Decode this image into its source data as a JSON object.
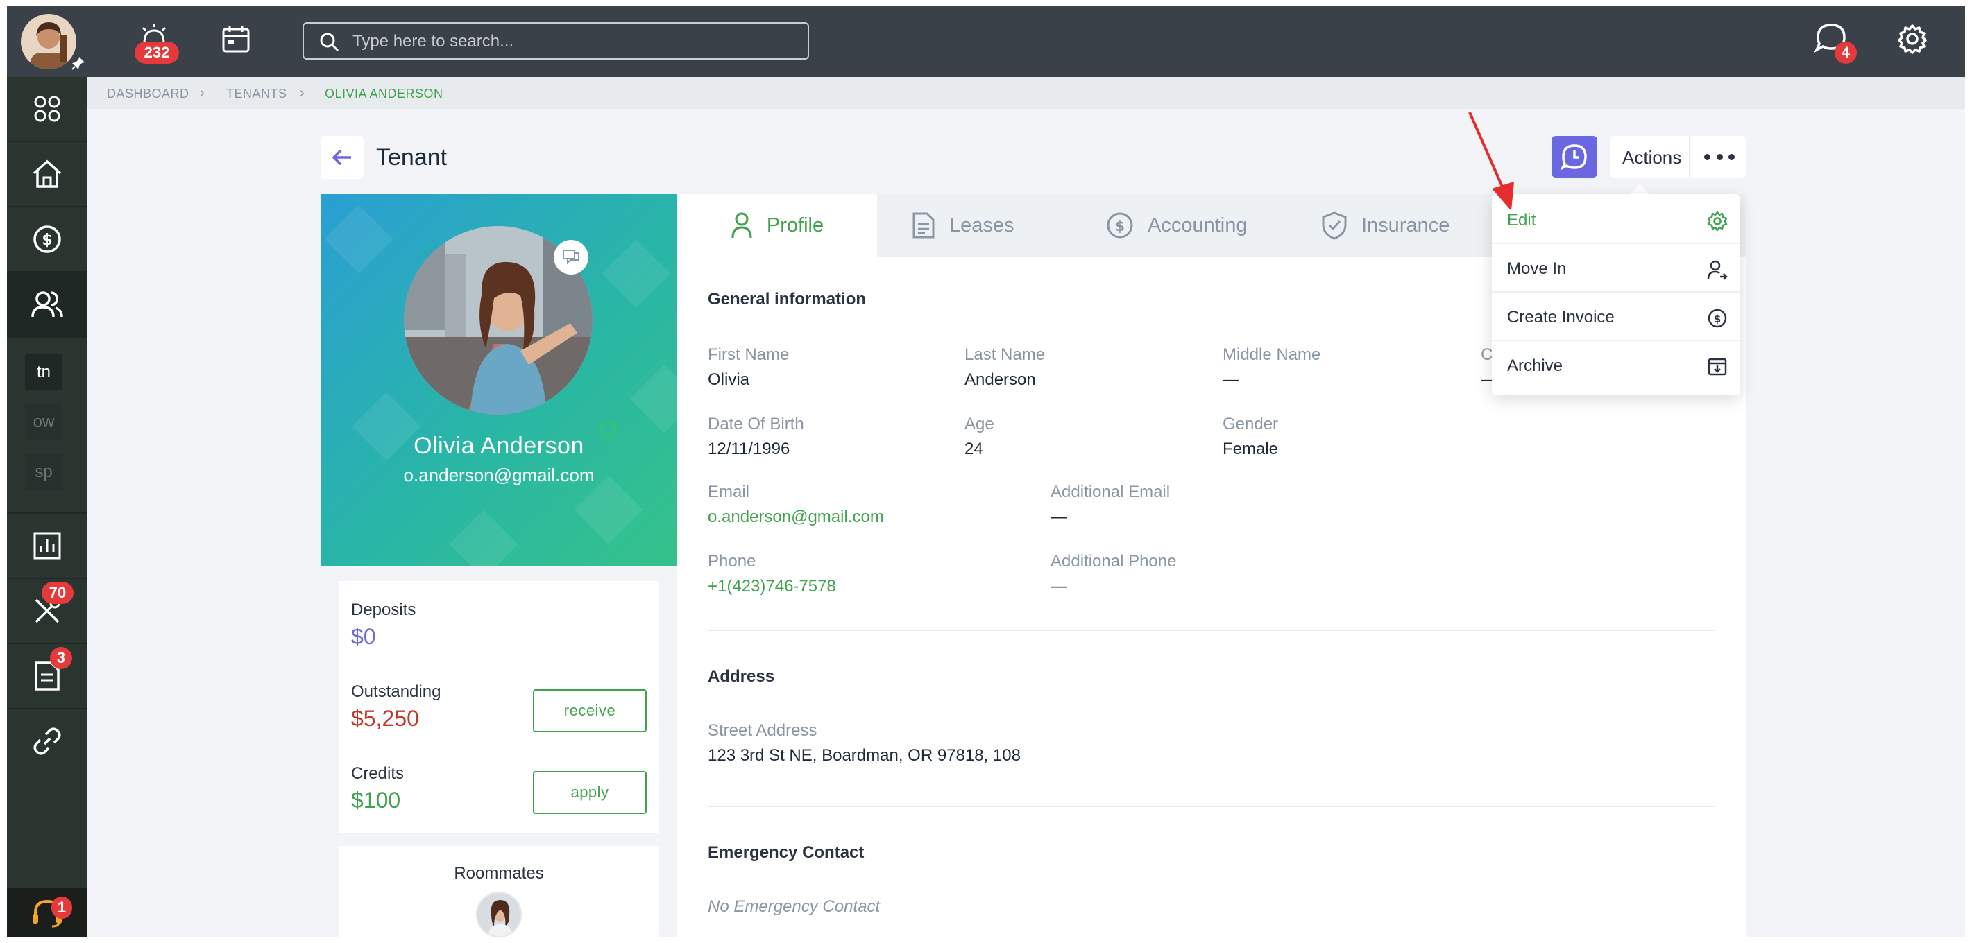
{
  "topbar": {
    "alerts_count": "232",
    "search_placeholder": "Type here to search...",
    "messages_count": "4"
  },
  "sidebar": {
    "items": [
      {
        "name": "apps"
      },
      {
        "name": "home"
      },
      {
        "name": "accounting"
      },
      {
        "name": "people"
      }
    ],
    "accounts": [
      "tn",
      "ow",
      "sp"
    ],
    "maintenance_badge": "70",
    "documents_badge": "3",
    "support_badge": "1"
  },
  "breadcrumb": [
    "DASHBOARD",
    "TENANTS",
    "OLIVIA ANDERSON"
  ],
  "page": {
    "title": "Tenant",
    "actions_label": "Actions"
  },
  "profile": {
    "name": "Olivia Anderson",
    "email": "o.anderson@gmail.com"
  },
  "finance": {
    "deposits_label": "Deposits",
    "deposits_value": "$0",
    "outstanding_label": "Outstanding",
    "outstanding_value": "$5,250",
    "receive_label": "receive",
    "credits_label": "Credits",
    "credits_value": "$100",
    "apply_label": "apply"
  },
  "roommates": {
    "title": "Roommates"
  },
  "tabs": [
    "Profile",
    "Leases",
    "Accounting",
    "Insurance"
  ],
  "general": {
    "title": "General information",
    "first_name_label": "First Name",
    "first_name": "Olivia",
    "last_name_label": "Last Name",
    "last_name": "Anderson",
    "middle_name_label": "Middle Name",
    "middle_name": "—",
    "hidden_label": "C",
    "hidden_value": "—",
    "dob_label": "Date Of Birth",
    "dob": "12/11/1996",
    "age_label": "Age",
    "age": "24",
    "gender_label": "Gender",
    "gender": "Female",
    "email_label": "Email",
    "email": "o.anderson@gmail.com",
    "add_email_label": "Additional Email",
    "add_email": "—",
    "phone_label": "Phone",
    "phone": "+1(423)746-7578",
    "add_phone_label": "Additional Phone",
    "add_phone": "—"
  },
  "address": {
    "title": "Address",
    "street_label": "Street Address",
    "street": "123 3rd St NE, Boardman, OR 97818, 108"
  },
  "emergency": {
    "title": "Emergency Contact",
    "empty": "No Emergency Contact"
  },
  "dropdown": {
    "items": [
      "Edit",
      "Move In",
      "Create Invoice",
      "Archive"
    ]
  },
  "colors": {
    "accent_green": "#3fa34d",
    "purple": "#6b67e0",
    "danger": "#c0392b",
    "badge_red": "#e5393b"
  }
}
